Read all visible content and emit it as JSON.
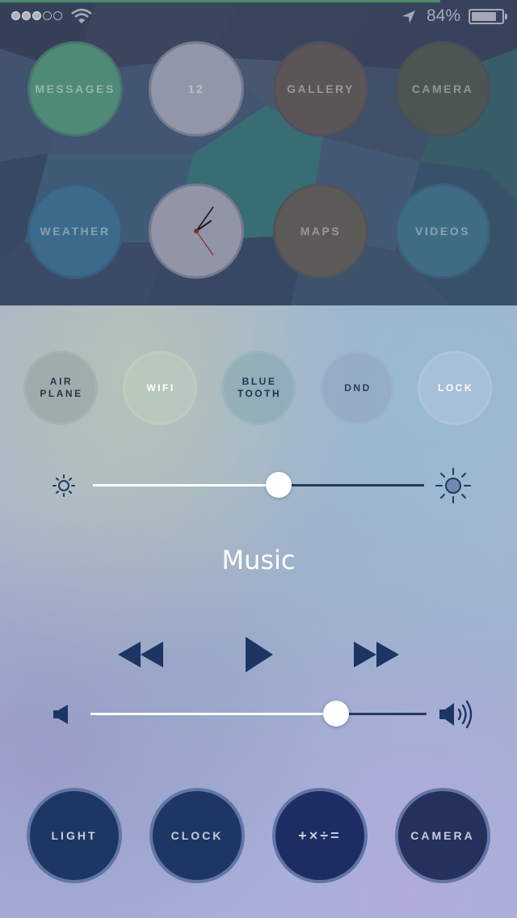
{
  "status_bar": {
    "signal_dots_filled": 3,
    "signal_dots_total": 5,
    "battery_percent_label": "84%",
    "battery_level": 0.84
  },
  "home": {
    "apps": [
      {
        "name": "messages",
        "label": "MESSAGES",
        "color": "#4f8a76"
      },
      {
        "name": "calendar",
        "label": "12",
        "color": "#9197a8"
      },
      {
        "name": "gallery",
        "label": "GALLERY",
        "color": "#5c5558"
      },
      {
        "name": "camera",
        "label": "CAMERA",
        "color": "#4d5553"
      },
      {
        "name": "weather",
        "label": "WEATHER",
        "color": "#3b6a8a"
      },
      {
        "name": "clock",
        "label": "",
        "color": "#9295a6"
      },
      {
        "name": "maps",
        "label": "MAPS",
        "color": "#5c5a56"
      },
      {
        "name": "videos",
        "label": "VIDEOS",
        "color": "#3e6c84"
      }
    ],
    "clock_hour_hand_angle": 55,
    "clock_minute_hand_angle": 35,
    "clock_second_hand_angle": 145
  },
  "control_center": {
    "toggles": [
      {
        "name": "airplane",
        "label": "AIR\nPLANE",
        "text_color": "#2a3346"
      },
      {
        "name": "wifi",
        "label": "WIFI",
        "text_color": "#ffffff"
      },
      {
        "name": "bluetooth",
        "label": "BLUE\nTOOTH",
        "text_color": "#233550"
      },
      {
        "name": "dnd",
        "label": "DND",
        "text_color": "#2a3d5c"
      },
      {
        "name": "lock",
        "label": "LOCK",
        "text_color": "#ffffff"
      }
    ],
    "brightness_level": 0.56,
    "music_title": "Music",
    "volume_level": 0.73,
    "shortcuts": [
      {
        "name": "light",
        "label": "LIGHT"
      },
      {
        "name": "clock",
        "label": "CLOCK"
      },
      {
        "name": "calculator",
        "label": "+×÷="
      },
      {
        "name": "camera",
        "label": "CAMERA"
      }
    ],
    "accent_dark": "#1d3563"
  }
}
